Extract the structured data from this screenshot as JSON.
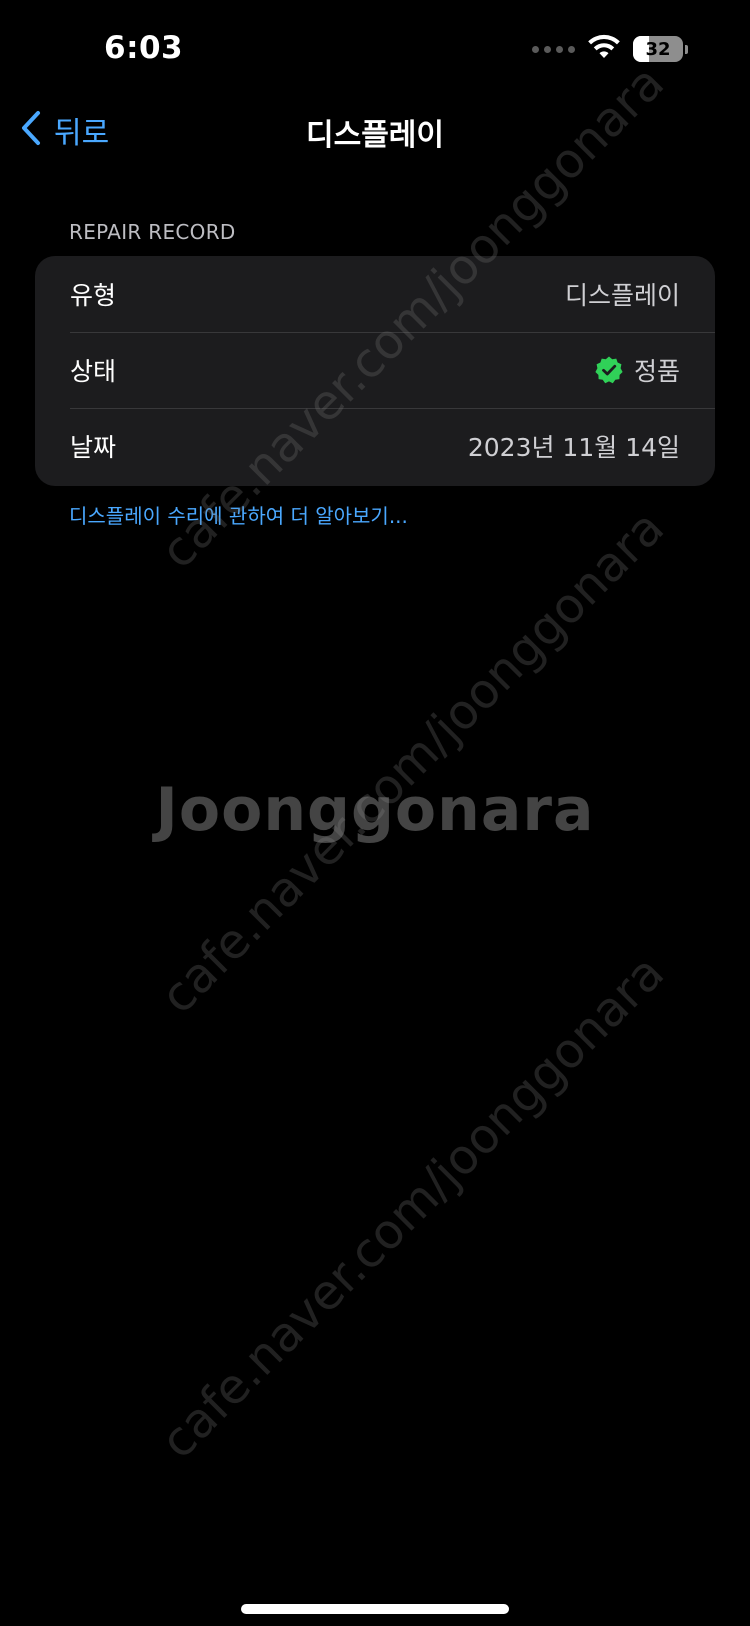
{
  "status_bar": {
    "time": "6:03",
    "battery_level": "32",
    "battery_fraction": 0.32
  },
  "nav": {
    "back_label": "뒤로",
    "title": "디스플레이"
  },
  "repair_record": {
    "header": "REPAIR RECORD",
    "rows": [
      {
        "label": "유형",
        "value": "디스플레이"
      },
      {
        "label": "상태",
        "value": "정품",
        "icon": "verified-check-icon"
      },
      {
        "label": "날짜",
        "value": "2023년 11월 14일"
      }
    ]
  },
  "learn_more_link": "디스플레이 수리에 관하여 더 알아보기...",
  "watermark": {
    "logo": "Joonggonara",
    "url": "cafe.naver.com/joonggonara"
  },
  "colors": {
    "accent": "#4aa8ff",
    "background": "#000000",
    "card": "#1c1c1e",
    "check_green": "#30d158"
  }
}
